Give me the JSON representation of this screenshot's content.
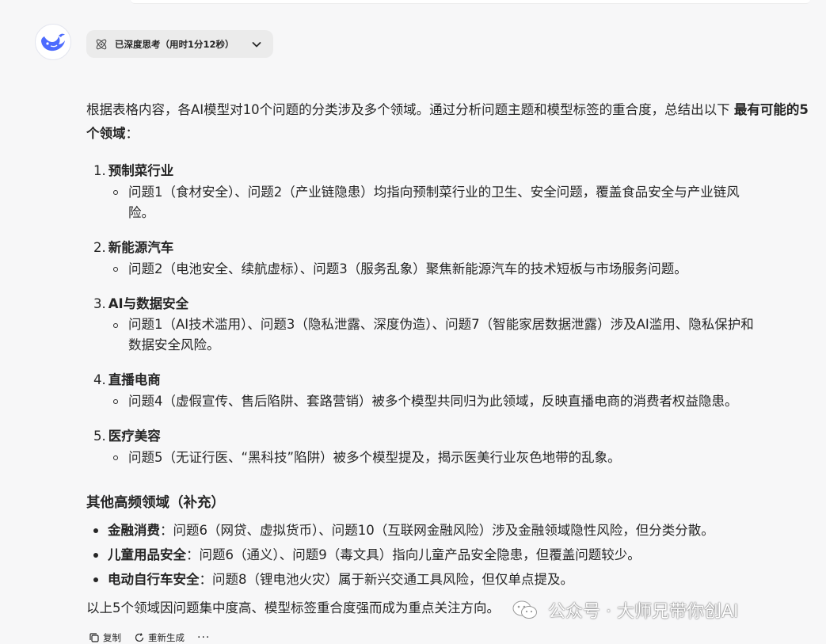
{
  "thinking": {
    "label": "已深度思考（用时1分12秒）"
  },
  "intro": {
    "text": "根据表格内容，各AI模型对10个问题的分类涉及多个领域。通过分析问题主题和模型标签的重合度，总结出以下",
    "bold": "最有可能的5个领域",
    "tail": "："
  },
  "sections": [
    {
      "num": "1.",
      "title": "预制菜行业",
      "lines": [
        "问题1（食材安全）、问题2（产业链隐患）均指向预制菜行业的卫生、安全问题，覆盖食品安全与产业链风",
        "险。"
      ]
    },
    {
      "num": "2.",
      "title": "新能源汽车",
      "lines": [
        "问题2（电池安全、续航虚标）、问题3（服务乱象）聚焦新能源汽车的技术短板与市场服务问题。"
      ]
    },
    {
      "num": "3.",
      "title": "AI与数据安全",
      "lines": [
        "问题1（AI技术滥用）、问题3（隐私泄露、深度伪造）、问题7（智能家居数据泄露）涉及AI滥用、隐私保护和",
        "数据安全风险。"
      ]
    },
    {
      "num": "4.",
      "title": "直播电商",
      "lines": [
        "问题4（虚假宣传、售后陷阱、套路营销）被多个模型共同归为此领域，反映直播电商的消费者权益隐患。"
      ]
    },
    {
      "num": "5.",
      "title": "医疗美容",
      "lines": [
        "问题5（无证行医、“黑科技”陷阱）被多个模型提及，揭示医美行业灰色地带的乱象。"
      ]
    }
  ],
  "other": {
    "heading": "其他高频领域（补充）",
    "items": [
      {
        "label": "金融消费",
        "text": "：问题6（网贷、虚拟货币）、问题10（互联网金融风险）涉及金融领域隐性风险，但分类分散。"
      },
      {
        "label": "儿童用品安全",
        "text": "：问题6（通义）、问题9（毒文具）指向儿童产品安全隐患，但覆盖问题较少。"
      },
      {
        "label": "电动自行车安全",
        "text": "：问题8（锂电池火灾）属于新兴交通工具风险，但仅单点提及。"
      }
    ]
  },
  "summary": "以上5个领域因问题集中度高、模型标签重合度强而成为重点关注方向。",
  "actions": {
    "copy": "复制",
    "regenerate": "重新生成",
    "more": "···"
  },
  "watermark": {
    "text": "公众号 · 大师兄带你创AI"
  },
  "colors": {
    "accent": "#4d6bfe",
    "background": "#f7f7f8",
    "toggle_bg": "#ebebeb",
    "text": "#262626"
  }
}
